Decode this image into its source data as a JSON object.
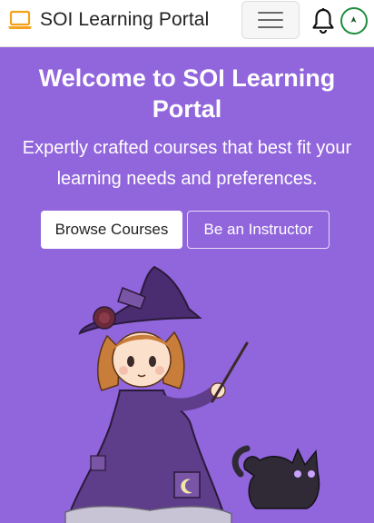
{
  "navbar": {
    "brand": "SOI Learning Portal",
    "brand_icon": "laptop-icon",
    "toggler_icon": "hamburger-menu-icon",
    "notification_icon": "bell-icon",
    "user_icon": "user-avatar-icon"
  },
  "hero": {
    "title": "Welcome to SOI Learning Portal",
    "subtitle": "Expertly crafted courses that best fit your learning needs and preferences.",
    "browse_button": "Browse Courses",
    "instructor_button": "Be an Instructor",
    "illustration": "witch-with-black-cat-illustration"
  },
  "colors": {
    "hero_background": "#9165dc",
    "navbar_background": "#ffffff",
    "brand_icon": "#f4a11b",
    "avatar_border": "#1e8e3e"
  }
}
